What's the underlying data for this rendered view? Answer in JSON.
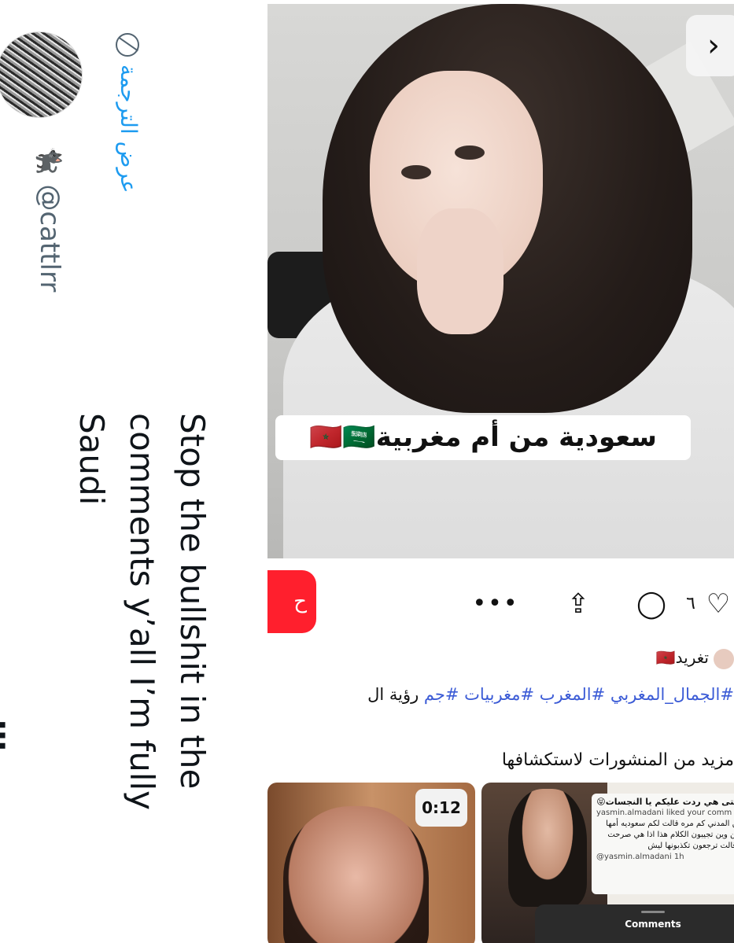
{
  "tweet": {
    "handle": "@cattlrr",
    "handle_emoji": "🐈‍⬛",
    "translate_label": "عرض الترجمة",
    "text": "Stop the bullshit in the comments y’all I’m fully Saudi",
    "cut_off_text": "…"
  },
  "post": {
    "image_caption": "سعودية من أم مغربية🇲🇦🇸🇦",
    "next_label": "›",
    "follow_button_label": "ح",
    "like_count": "٦",
    "author_name": "تغريد🇲🇦",
    "hashtags": "#الجمال_المغربي #المغرب #مغربيات #جم",
    "see_translation": "رؤية ال",
    "more_posts_title": "مزيد من المنشورات لاستكشافها",
    "icons": {
      "more": "more-dots-icon",
      "share": "share-icon",
      "comment": "comment-icon",
      "like": "heart-icon"
    }
  },
  "cards": {
    "video_duration": "0:12",
    "notice_title": "حتى هي ردت عليكم يا النجسات😝",
    "notice_line1": "yasmin.almadani liked your comm",
    "notice_line2": "ين المدني كم مره قالت لكم سعوديه أمها",
    "notice_line3": "من وين تجيبون الكلام هذا اذا هي صرحت",
    "notice_line4": "وقالت ترجعون تكذبونها ليش",
    "notice_line5": "@yasmin.almadani 1h",
    "comments_label": "Comments"
  },
  "colors": {
    "link_blue": "#1d9bf0",
    "hashtag_blue": "#3b5bd6",
    "accent_red": "#ff1f2d"
  }
}
